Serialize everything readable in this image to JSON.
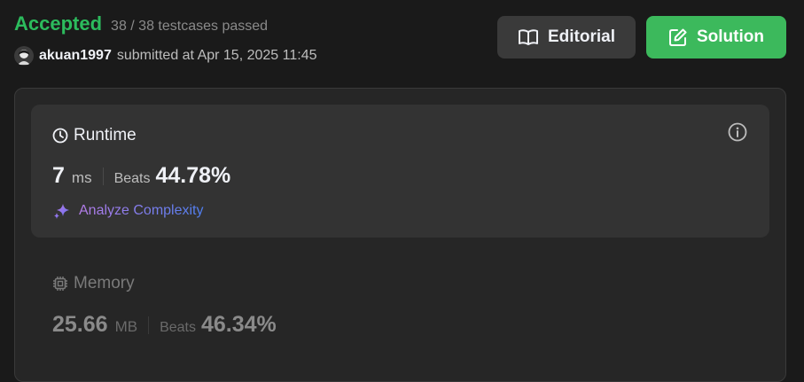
{
  "submission": {
    "status": "Accepted",
    "testcases": "38 / 38 testcases passed",
    "username": "akuan1997",
    "submitted_text": "submitted at Apr 15, 2025 11:45"
  },
  "buttons": {
    "editorial": "Editorial",
    "solution": "Solution"
  },
  "runtime": {
    "title": "Runtime",
    "value": "7",
    "unit": "ms",
    "beats_label": "Beats",
    "beats_value": "44.78%",
    "analyze_label": "Analyze Complexity"
  },
  "memory": {
    "title": "Memory",
    "value": "25.66",
    "unit": "MB",
    "beats_label": "Beats",
    "beats_value": "46.34%"
  },
  "colors": {
    "accepted": "#2cbb5d",
    "solution_button": "#3cb95c",
    "editorial_button": "#3a3a3a",
    "background": "#1a1a1a"
  },
  "icons": {
    "editorial": "book-open-icon",
    "solution": "edit-icon",
    "runtime": "clock-icon",
    "memory": "chip-icon",
    "info": "info-icon",
    "analyze": "sparkle-icon"
  }
}
